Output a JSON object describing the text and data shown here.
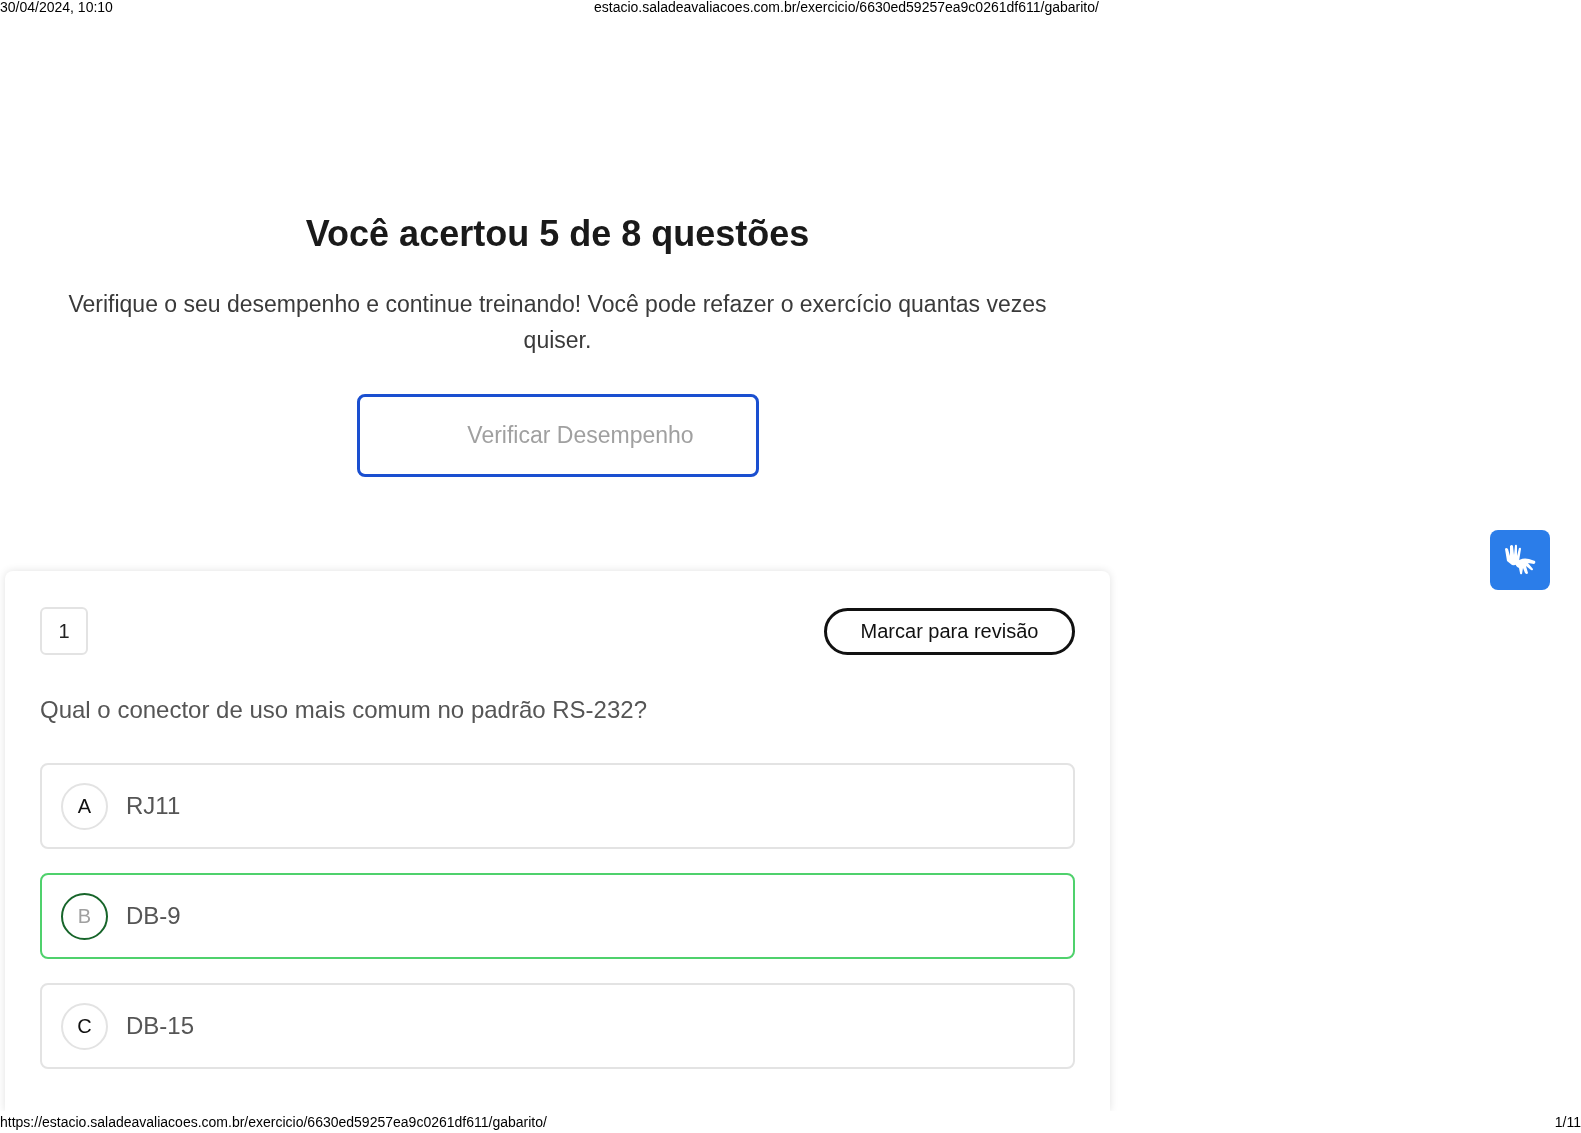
{
  "print_header": {
    "date": "30/04/2024, 10:10",
    "url": "estacio.saladeavaliacoes.com.br/exercicio/6630ed59257ea9c0261df611/gabarito/"
  },
  "result": {
    "title": "Você acertou 5 de 8 questões",
    "message": "Verifique o seu desempenho e continue treinando! Você pode refazer o exercício quantas vezes quiser.",
    "button": "Verificar Desempenho"
  },
  "question": {
    "number": "1",
    "review_button": "Marcar para revisão",
    "text": "Qual o conector de uso mais comum no padrão RS-232?",
    "options": [
      {
        "letter": "A",
        "text": "RJ11",
        "correct": false
      },
      {
        "letter": "B",
        "text": "DB-9",
        "correct": true
      },
      {
        "letter": "C",
        "text": "DB-15",
        "correct": false
      }
    ]
  },
  "print_footer": {
    "url": "https://estacio.saladeavaliacoes.com.br/exercicio/6630ed59257ea9c0261df611/gabarito/",
    "page": "1/11"
  }
}
